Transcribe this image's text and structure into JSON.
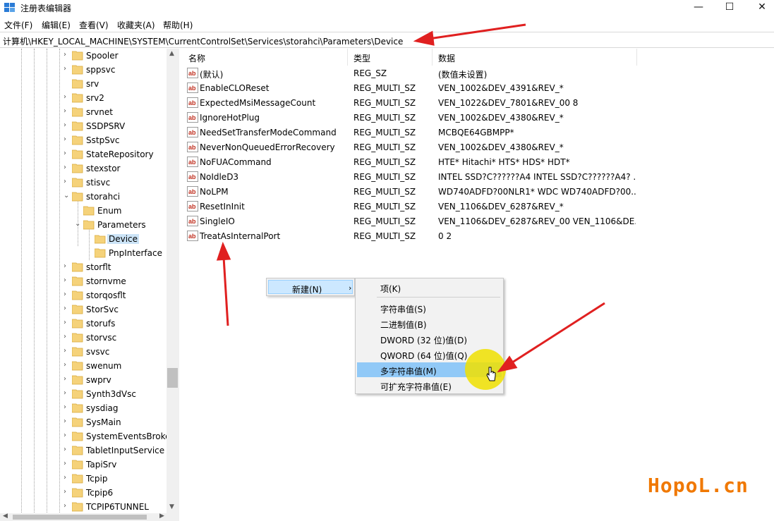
{
  "window": {
    "title": "注册表编辑器",
    "controls": {
      "minimize": "—",
      "maximize": "☐",
      "close": "✕"
    }
  },
  "menubar": {
    "items": [
      {
        "label": "文件(F)"
      },
      {
        "label": "编辑(E)"
      },
      {
        "label": "查看(V)"
      },
      {
        "label": "收藏夹(A)"
      },
      {
        "label": "帮助(H)"
      }
    ]
  },
  "address": {
    "path": "计算机\\HKEY_LOCAL_MACHINE\\SYSTEM\\CurrentControlSet\\Services\\storahci\\Parameters\\Device"
  },
  "tree": {
    "items": [
      {
        "label": "Spooler",
        "chev": "›"
      },
      {
        "label": "sppsvc",
        "chev": "›"
      },
      {
        "label": "srv",
        "chev": ""
      },
      {
        "label": "srv2",
        "chev": "›"
      },
      {
        "label": "srvnet",
        "chev": "›"
      },
      {
        "label": "SSDPSRV",
        "chev": "›"
      },
      {
        "label": "SstpSvc",
        "chev": "›"
      },
      {
        "label": "StateRepository",
        "chev": "›"
      },
      {
        "label": "stexstor",
        "chev": "›"
      },
      {
        "label": "stisvc",
        "chev": "›"
      },
      {
        "label": "storahci",
        "chev": "⌄"
      },
      {
        "label": "Enum",
        "chev": ""
      },
      {
        "label": "Parameters",
        "chev": "⌄"
      },
      {
        "label": "Device",
        "chev": ""
      },
      {
        "label": "PnpInterface",
        "chev": ""
      },
      {
        "label": "storflt",
        "chev": "›"
      },
      {
        "label": "stornvme",
        "chev": "›"
      },
      {
        "label": "storqosflt",
        "chev": "›"
      },
      {
        "label": "StorSvc",
        "chev": "›"
      },
      {
        "label": "storufs",
        "chev": "›"
      },
      {
        "label": "storvsc",
        "chev": "›"
      },
      {
        "label": "svsvc",
        "chev": "›"
      },
      {
        "label": "swenum",
        "chev": "›"
      },
      {
        "label": "swprv",
        "chev": "›"
      },
      {
        "label": "Synth3dVsc",
        "chev": "›"
      },
      {
        "label": "sysdiag",
        "chev": "›"
      },
      {
        "label": "SysMain",
        "chev": "›"
      },
      {
        "label": "SystemEventsBroke",
        "chev": "›"
      },
      {
        "label": "TabletInputService",
        "chev": "›"
      },
      {
        "label": "TapiSrv",
        "chev": "›"
      },
      {
        "label": "Tcpip",
        "chev": "›"
      },
      {
        "label": "Tcpip6",
        "chev": "›"
      },
      {
        "label": "TCPIP6TUNNEL",
        "chev": "›"
      }
    ]
  },
  "list": {
    "headers": {
      "name": "名称",
      "type": "类型",
      "data": "数据"
    },
    "rows": [
      {
        "name": "(默认)",
        "type": "REG_SZ",
        "data": "(数值未设置)"
      },
      {
        "name": "EnableCLOReset",
        "type": "REG_MULTI_SZ",
        "data": "VEN_1002&DEV_4391&REV_*"
      },
      {
        "name": "ExpectedMsiMessageCount",
        "type": "REG_MULTI_SZ",
        "data": "VEN_1022&DEV_7801&REV_00 8"
      },
      {
        "name": "IgnoreHotPlug",
        "type": "REG_MULTI_SZ",
        "data": "VEN_1002&DEV_4380&REV_*"
      },
      {
        "name": "NeedSetTransferModeCommand",
        "type": "REG_MULTI_SZ",
        "data": "MCBQE64GBMPP*"
      },
      {
        "name": "NeverNonQueuedErrorRecovery",
        "type": "REG_MULTI_SZ",
        "data": "VEN_1002&DEV_4380&REV_*"
      },
      {
        "name": "NoFUACommand",
        "type": "REG_MULTI_SZ",
        "data": "HTE* Hitachi* HTS* HDS* HDT*"
      },
      {
        "name": "NoIdleD3",
        "type": "REG_MULTI_SZ",
        "data": "INTEL SSD?C??????A4 INTEL SSD?C??????A4? ..."
      },
      {
        "name": "NoLPM",
        "type": "REG_MULTI_SZ",
        "data": "WD740ADFD?00NLR1* WDC WD740ADFD?00..."
      },
      {
        "name": "ResetInInit",
        "type": "REG_MULTI_SZ",
        "data": "VEN_1106&DEV_6287&REV_*"
      },
      {
        "name": "SingleIO",
        "type": "REG_MULTI_SZ",
        "data": "VEN_1106&DEV_6287&REV_00 VEN_1106&DE..."
      },
      {
        "name": "TreatAsInternalPort",
        "type": "REG_MULTI_SZ",
        "data": "0 2"
      }
    ]
  },
  "context_menu": {
    "new_label": "新建(N)",
    "submenu": [
      {
        "label": "项(K)"
      },
      {
        "label": "字符串值(S)"
      },
      {
        "label": "二进制值(B)"
      },
      {
        "label": "DWORD (32 位)值(D)"
      },
      {
        "label": "QWORD (64 位)值(Q)"
      },
      {
        "label": "多字符串值(M)"
      },
      {
        "label": "可扩充字符串值(E)"
      }
    ]
  },
  "watermark": {
    "text": "HopoL.cn"
  },
  "colors": {
    "selection": "#cce4f7",
    "menu_hover": "#91c9f7",
    "annotation": "#e02020",
    "folder": "#f5d27a",
    "watermark": "#f07800"
  }
}
